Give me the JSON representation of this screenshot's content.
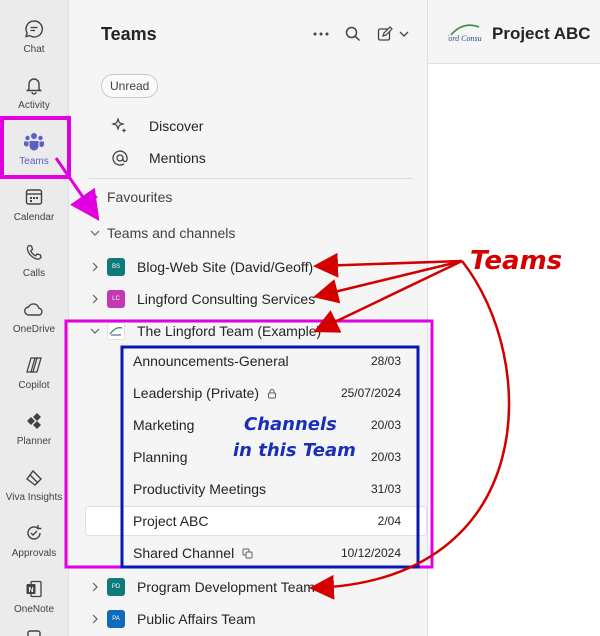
{
  "rail": {
    "items": [
      {
        "label": "Chat",
        "icon": "chat-icon"
      },
      {
        "label": "Activity",
        "icon": "bell-icon"
      },
      {
        "label": "Teams",
        "icon": "teams-icon"
      },
      {
        "label": "Calendar",
        "icon": "calendar-icon"
      },
      {
        "label": "Calls",
        "icon": "phone-icon"
      },
      {
        "label": "OneDrive",
        "icon": "cloud-icon"
      },
      {
        "label": "Copilot",
        "icon": "copilot-icon"
      },
      {
        "label": "Planner",
        "icon": "planner-icon"
      },
      {
        "label": "Viva Insights",
        "icon": "viva-insights-icon"
      },
      {
        "label": "Approvals",
        "icon": "approvals-icon"
      },
      {
        "label": "OneNote",
        "icon": "onenote-icon"
      }
    ],
    "active_color": "#5b5fc7"
  },
  "pane": {
    "title": "Teams",
    "filter_chip": "Unread",
    "quick_links": [
      {
        "label": "Discover",
        "icon": "sparkle-icon"
      },
      {
        "label": "Mentions",
        "icon": "at-icon"
      }
    ],
    "sections": {
      "favourites": "Favourites",
      "teams_and_channels": "Teams and channels"
    },
    "teams": [
      {
        "name": "Blog-Web Site (David/Geoff)",
        "initials": "BS",
        "color": "#0f7a7a"
      },
      {
        "name": "Lingford Consulting Services",
        "initials": "LC",
        "color": "#c239b3"
      },
      {
        "name": "The Lingford Team (Example)",
        "initials": "",
        "color": "#ffffff"
      },
      {
        "name": "Program Development Team",
        "initials": "PD",
        "color": "#0f7a7a"
      },
      {
        "name": "Public Affairs Team",
        "initials": "PA",
        "color": "#0f6cbd"
      }
    ],
    "channels": [
      {
        "name": "Announcements-General",
        "date": "28/03",
        "icon": ""
      },
      {
        "name": "Leadership (Private)",
        "date": "25/07/2024",
        "icon": "lock-icon"
      },
      {
        "name": "Marketing",
        "date": "20/03",
        "icon": ""
      },
      {
        "name": "Planning",
        "date": "20/03",
        "icon": ""
      },
      {
        "name": "Productivity Meetings",
        "date": "31/03",
        "icon": ""
      },
      {
        "name": "Project ABC",
        "date": "2/04",
        "icon": ""
      },
      {
        "name": "Shared Channel",
        "date": "10/12/2024",
        "icon": "shared-icon"
      }
    ]
  },
  "main": {
    "title": "Project ABC",
    "logo_text": "ford Consul"
  },
  "annotations": {
    "teams_label": "Teams",
    "channels_line1": "Channels",
    "channels_line2": "in this Team",
    "teams_color": "#d40000",
    "channels_color": "#1a2fb8",
    "highlight_color": "#e000e0",
    "channel_box_color": "#0a18b0"
  }
}
